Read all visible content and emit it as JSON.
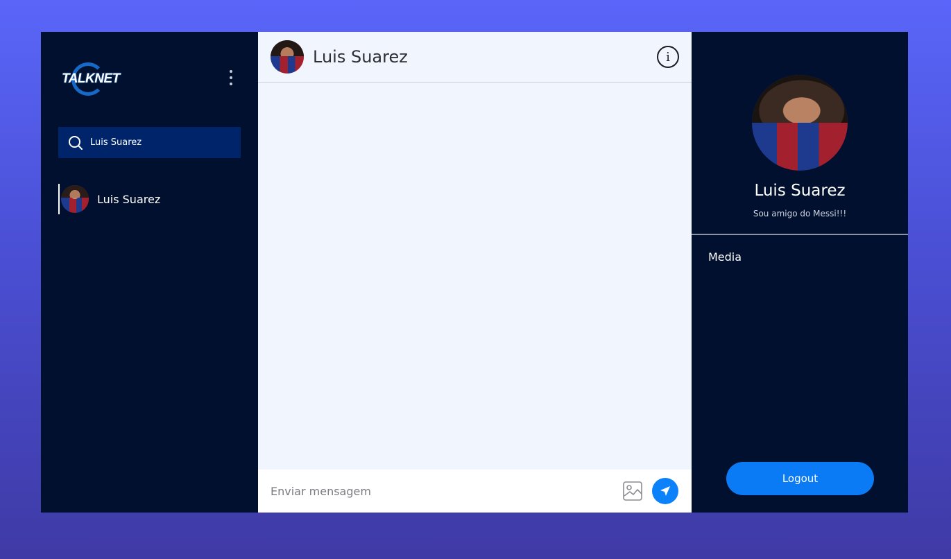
{
  "sidebar": {
    "logo_text": "TALKNET",
    "search": {
      "value": "Luis Suarez",
      "placeholder": ""
    },
    "contacts": [
      {
        "name": "Luis Suarez"
      }
    ]
  },
  "chat": {
    "header": {
      "name": "Luis Suarez"
    },
    "composer": {
      "placeholder": "Enviar mensagem"
    }
  },
  "profile": {
    "name": "Luis Suarez",
    "status": "Sou amigo do Messi!!!",
    "media_label": "Media",
    "logout_label": "Logout"
  },
  "colors": {
    "background_top": "#5a66f9",
    "background_bottom": "#3f3aa5",
    "panel_dark": "#00102e",
    "search_bg": "#002469",
    "chat_bg": "#f0f5fe",
    "accent": "#0b82fa"
  },
  "icons": [
    "menu-dots-icon",
    "search-icon",
    "info-icon",
    "image-icon",
    "send-icon"
  ]
}
